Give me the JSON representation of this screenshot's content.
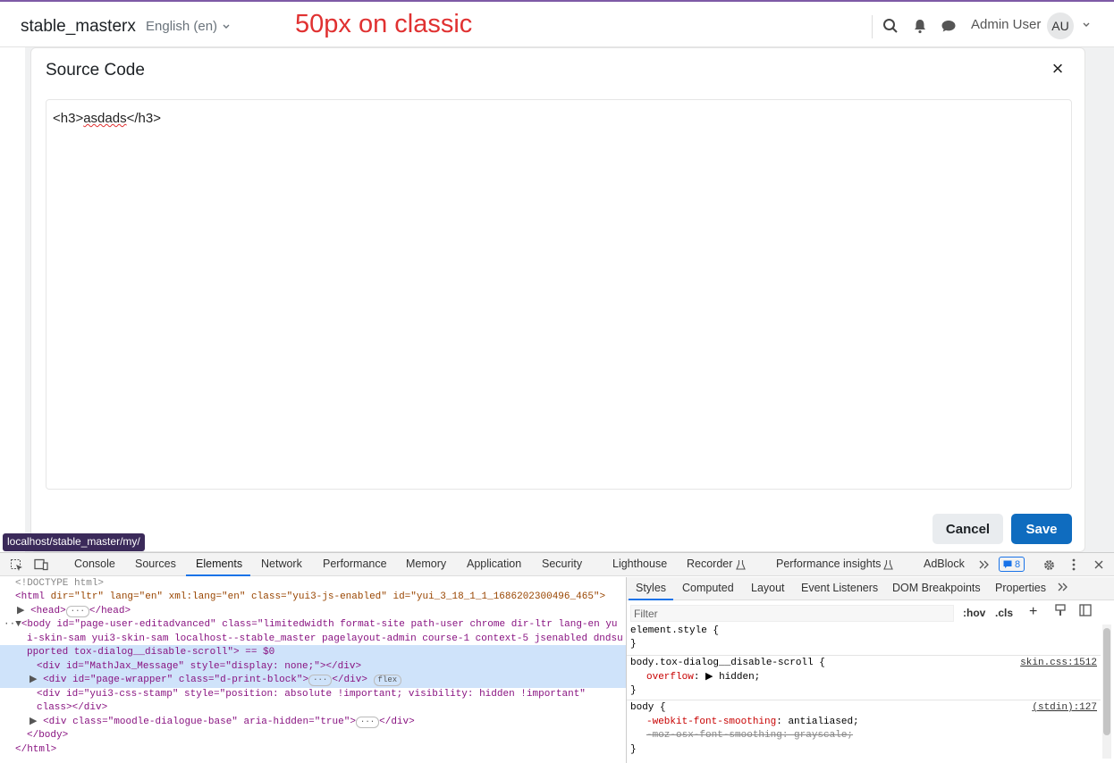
{
  "navbar": {
    "site_name": "stable_masterx",
    "language": "English (en)",
    "annotation": "50px on classic",
    "user_name": "Admin User",
    "avatar_initials": "AU"
  },
  "modal": {
    "title": "Source Code",
    "close": "×",
    "code_open": "<h3>",
    "code_text": "asdads",
    "code_close": "</h3>",
    "cancel_label": "Cancel",
    "save_label": "Save"
  },
  "status_url": "localhost/stable_master/my/",
  "devtools": {
    "tabs": [
      "Console",
      "Sources",
      "Elements",
      "Network",
      "Performance",
      "Memory",
      "Application",
      "Security",
      "Lighthouse",
      "Recorder",
      "Performance insights",
      "AdBlock"
    ],
    "active_tab": "Elements",
    "badge_count": "8",
    "dom": {
      "l0": "<!DOCTYPE html>",
      "l1_tag": "<html",
      "l1_attrs": " dir=\"ltr\" lang=\"en\" xml:lang=\"en\" class=\"yui3-js-enabled\" id=\"yui_3_18_1_1_1686202300496_465\">",
      "l2": "<head>",
      "l2b": "</head>",
      "l3a": "<body id=\"page-user-editadvanced\" class=\"limitedwidth format-site path-user chrome dir-ltr lang-en yu",
      "l3b": "i-skin-sam yui3-skin-sam localhost--stable_master pagelayout-admin course-1 context-5 jsenabled dndsu",
      "l3c": "pported tox-dialog__disable-scroll\"> == $0",
      "l4": "<div id=\"MathJax_Message\" style=\"display: none;\"></div>",
      "l5": "<div id=\"page-wrapper\" class=\"d-print-block\">",
      "l5b": "</div>",
      "l5_pill": "flex",
      "l6": "<div id=\"yui3-css-stamp\" style=\"position: absolute !important; visibility: hidden !important\"",
      "l7": "class></div>",
      "l8": "<div class=\"moodle-dialogue-base\" aria-hidden=\"true\">",
      "l8b": "</div>",
      "l9": "</body>",
      "l10": "</html>"
    },
    "side_tabs": [
      "Styles",
      "Computed",
      "Layout",
      "Event Listeners",
      "DOM Breakpoints",
      "Properties"
    ],
    "filter_placeholder": "Filter",
    "hov": ":hov",
    "cls": ".cls",
    "rules": {
      "r1": "element.style {",
      "r1c": "}",
      "r2": "body.tox-dialog__disable-scroll {",
      "r2_src": "skin.css:1512",
      "r2_prop": "overflow",
      "r2_val": "hidden;",
      "r2c": "}",
      "r3": "body {",
      "r3_src": "(stdin):127",
      "r3_p1": "-webkit-font-smoothing",
      "r3_v1": "antialiased;",
      "r3_p2": "-moz-osx-font-smoothing: grayscale;",
      "r3c": "}"
    }
  }
}
